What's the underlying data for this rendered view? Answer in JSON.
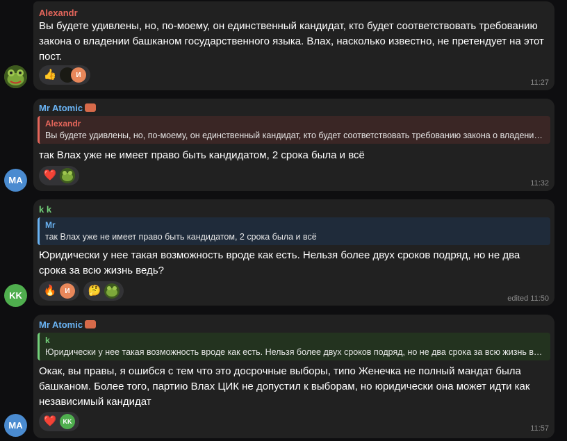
{
  "messages": [
    {
      "sender": "Alexandr",
      "text": "Вы будете удивлены, но, по-моему, он единственный кандидат, кто будет соответствовать требованию закона о владении башканом государственного языка. Влах, насколько известно, не претендует на этот пост.",
      "time": "11:27",
      "reactions": [
        {
          "emoji": "👍",
          "avatars": [
            "dark",
            "И"
          ]
        }
      ]
    },
    {
      "sender": "Mr Atomic",
      "reply": {
        "name": "Alexandr",
        "text": "Вы будете удивлены, но, по-моему, он единственный кандидат, кто будет соответствовать требованию закона о владении башканом государственного языка."
      },
      "text": "так Влах уже не имеет право быть кандидатом, 2 срока была и всё",
      "time": "11:32",
      "avatar": "MA",
      "reactions": [
        {
          "emoji": "❤️",
          "avatars": [
            "frog"
          ]
        }
      ]
    },
    {
      "sender": "k k",
      "reply": {
        "name": "Mr",
        "text": "так Влах уже не имеет право быть кандидатом, 2 срока была и всё"
      },
      "text": "Юридически у нее такая возможность вроде как есть. Нельзя более двух сроков подряд, но не два срока за всю жизнь ведь?",
      "time": "edited 11:50",
      "avatar": "KK",
      "reactions": [
        {
          "emoji": "🔥",
          "avatars": [
            "И"
          ]
        },
        {
          "emoji": "🤔",
          "avatars": [
            "frog"
          ]
        }
      ]
    },
    {
      "sender": "Mr Atomic",
      "reply": {
        "name": "k",
        "text": "Юридически у нее такая возможность вроде как есть. Нельзя более двух сроков подряд, но не два срока за всю жизнь ведь?"
      },
      "text": "Окак, вы правы, я ошибся с тем что это досрочные выборы, типо Женечка не полный мандат была башканом. Более того, партию Влах ЦИК не допустил к выборам, но юридически она может идти как независимый кандидат",
      "time": "11:57",
      "avatar": "MA",
      "reactions": [
        {
          "emoji": "❤️",
          "avatars": [
            "KK"
          ]
        }
      ]
    }
  ],
  "colors": {
    "alexandr": "#e5665b",
    "mr_atomic": "#6ab3f3",
    "kk": "#73d07a",
    "bubble": "#212121",
    "bg": "#0e0e10"
  }
}
